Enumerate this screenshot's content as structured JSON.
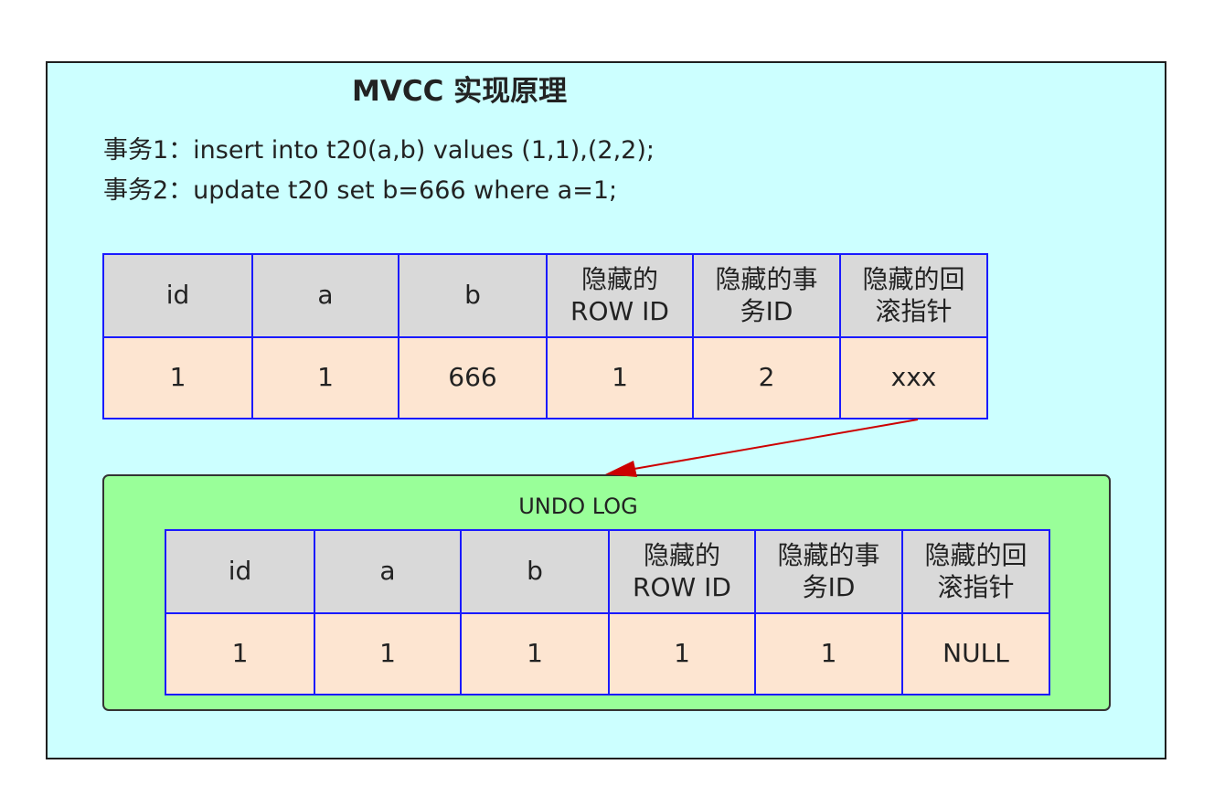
{
  "title": "MVCC 实现原理",
  "transactions": [
    "事务1：insert into t20(a,b) values (1,1),(2,2);",
    "事务2：update t20 set b=666 where a=1;"
  ],
  "table_headers": [
    "id",
    "a",
    "b",
    "隐藏的\nROW ID",
    "隐藏的事\n务ID",
    "隐藏的回\n滚指针"
  ],
  "current_row": [
    "1",
    "1",
    "666",
    "1",
    "2",
    "xxx"
  ],
  "undo_log": {
    "label": "UNDO LOG",
    "headers": [
      "id",
      "a",
      "b",
      "隐藏的\nROW ID",
      "隐藏的事\n务ID",
      "隐藏的回\n滚指针"
    ],
    "row": [
      "1",
      "1",
      "1",
      "1",
      "1",
      "NULL"
    ]
  },
  "colors": {
    "panel_bg": "#ccffff",
    "undo_bg": "#99ff99",
    "header_bg": "#d9d9d9",
    "row_bg": "#fde5d1",
    "table_border": "#1a1aff",
    "arrow": "#cc0000"
  }
}
